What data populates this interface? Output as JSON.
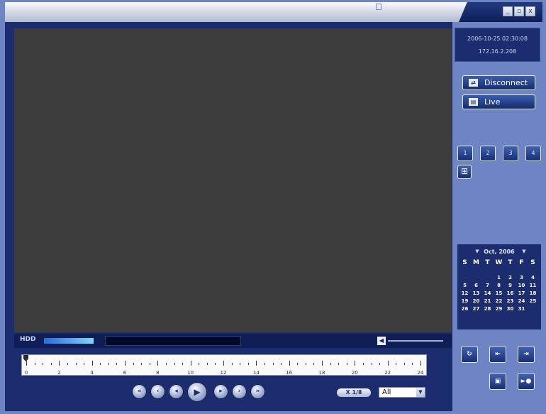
{
  "window": {
    "controls": {
      "minimize": "minimize-icon",
      "restore": "restore-icon",
      "close": "close-icon"
    }
  },
  "status": {
    "datetime": "2006-10-25 02:30:08",
    "ip": "172.16.2.208"
  },
  "buttons": {
    "disconnect": "Disconnect",
    "live": "Live"
  },
  "channels": [
    "1",
    "2",
    "3",
    "4"
  ],
  "calendar": {
    "month": "Oct, 2006",
    "weekdays": [
      "S",
      "M",
      "T",
      "W",
      "T",
      "F",
      "S"
    ],
    "weeks": [
      [
        "",
        "",
        "",
        "",
        "1",
        "2",
        "3",
        "4"
      ],
      [
        "5",
        "6",
        "7",
        "8",
        "9",
        "10",
        "11"
      ],
      [
        "12",
        "13",
        "14",
        "15",
        "16",
        "17",
        "18"
      ],
      [
        "19",
        "20",
        "21",
        "22",
        "23",
        "24",
        "25"
      ],
      [
        "26",
        "27",
        "28",
        "29",
        "30",
        "31",
        ""
      ]
    ]
  },
  "bottom": {
    "hdd_label": "HDD",
    "timeline_labels": [
      "0",
      "2",
      "4",
      "6",
      "8",
      "10",
      "12",
      "14",
      "16",
      "18",
      "20",
      "22",
      "24"
    ],
    "speed": "X 1/8",
    "filter_value": "All"
  },
  "playback_icons": [
    "slowest-icon",
    "slow-icon",
    "step-back-icon",
    "play-icon",
    "step-forward-icon",
    "fast-icon",
    "fastest-icon"
  ],
  "colors": {
    "frame": "#1b2d6e",
    "panel": "#6e84c4",
    "video_area": "#3d3d3d"
  }
}
